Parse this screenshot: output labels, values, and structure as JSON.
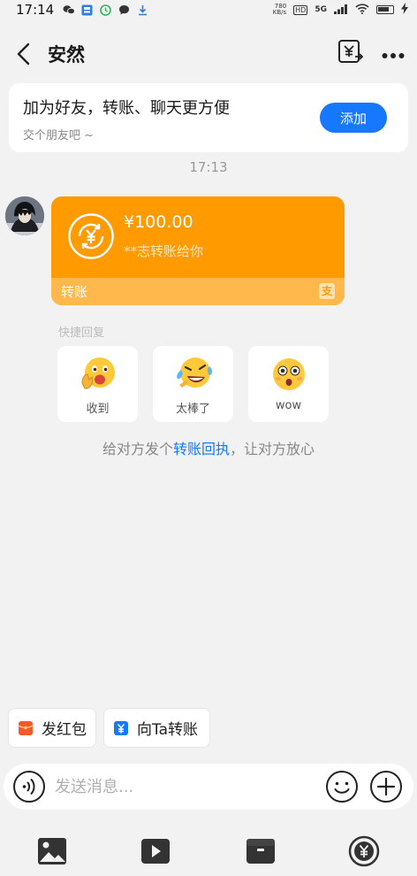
{
  "status_bar": {
    "time": "17:14",
    "left_icons": [
      "wechat-icon",
      "id-card-icon",
      "clock-app-icon",
      "chat-bubble-icon",
      "download-icon"
    ],
    "net_speed_value": "780",
    "net_speed_unit": "KB/s",
    "hd": "HD",
    "network": "5G"
  },
  "header": {
    "title": "安然"
  },
  "add_friend": {
    "title": "加为好友，转账、聊天更方便",
    "subtitle": "交个朋友吧 ~",
    "button": "添加"
  },
  "timestamp": "17:13",
  "transfer": {
    "amount": "¥100.00",
    "note": "**志转账给你",
    "footer_label": "转账",
    "footer_icon_char": "支"
  },
  "quick_reply": {
    "title": "快捷回复",
    "items": [
      {
        "label": "收到",
        "emoji": "ok-hand-face"
      },
      {
        "label": "太棒了",
        "emoji": "laughing-tears-face"
      },
      {
        "label": "wow",
        "emoji": "surprised-face"
      }
    ]
  },
  "hint": {
    "before": "给对方发个",
    "link": "转账回执",
    "after": "，让对方放心"
  },
  "chips": {
    "red_packet": "发红包",
    "transfer_to": "向Ta转账"
  },
  "input": {
    "placeholder": "发送消息..."
  },
  "colors": {
    "accent_blue": "#1677ff",
    "transfer_orange": "#ff9b00",
    "transfer_footer": "#ffb84b",
    "red_packet": "#f25a2b"
  }
}
